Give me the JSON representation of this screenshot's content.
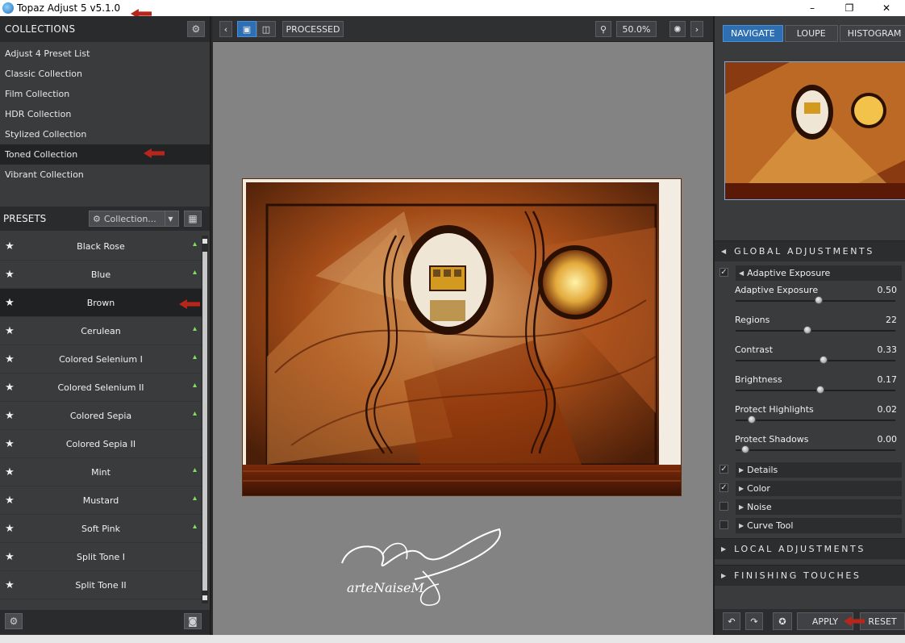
{
  "window": {
    "title": "Topaz Adjust 5 v5.1.0",
    "minimize": "–",
    "restore": "❐",
    "close": "✕"
  },
  "collections": {
    "header": "COLLECTIONS",
    "items": [
      "Adjust 4 Preset List",
      "Classic Collection",
      "Film Collection",
      "HDR Collection",
      "Stylized Collection",
      "Toned Collection",
      "Vibrant Collection"
    ],
    "selected": "Toned Collection"
  },
  "presets": {
    "header": "PRESETS",
    "dropdown": "Collection...",
    "items": [
      "Black Rose",
      "Blue",
      "Brown",
      "Cerulean",
      "Colored Selenium I",
      "Colored Selenium II",
      "Colored Sepia",
      "Colored Sepia II",
      "Mint",
      "Mustard",
      "Soft Pink",
      "Split Tone I",
      "Split Tone II"
    ],
    "selected": "Brown"
  },
  "toolbar": {
    "view_mode": "PROCESSED",
    "zoom": "50.0%"
  },
  "right_tabs": [
    "NAVIGATE",
    "LOUPE",
    "HISTOGRAM"
  ],
  "global_adjustments": {
    "header": "GLOBAL ADJUSTMENTS",
    "section": "Adaptive Exposure",
    "sliders": [
      {
        "name": "Adaptive Exposure",
        "value": "0.50",
        "level": 0.52
      },
      {
        "name": "Regions",
        "value": "22",
        "level": 0.45
      },
      {
        "name": "Contrast",
        "value": "0.33",
        "level": 0.55
      },
      {
        "name": "Brightness",
        "value": "0.17",
        "level": 0.53
      },
      {
        "name": "Protect Highlights",
        "value": "0.02",
        "level": 0.1
      },
      {
        "name": "Protect Shadows",
        "value": "0.00",
        "level": 0.06
      }
    ],
    "subsections": [
      "Details",
      "Color",
      "Noise",
      "Curve Tool"
    ]
  },
  "local_adjustments": {
    "header": "LOCAL ADJUSTMENTS"
  },
  "finishing_touches": {
    "header": "FINISHING TOUCHES"
  },
  "buttons": {
    "apply": "APPLY",
    "reset": "RESET"
  },
  "signature": "arteNaiseM",
  "colors": {
    "accent": "#2e6fb3",
    "panel": "#3a3b3d",
    "marker": "#b8261b"
  }
}
